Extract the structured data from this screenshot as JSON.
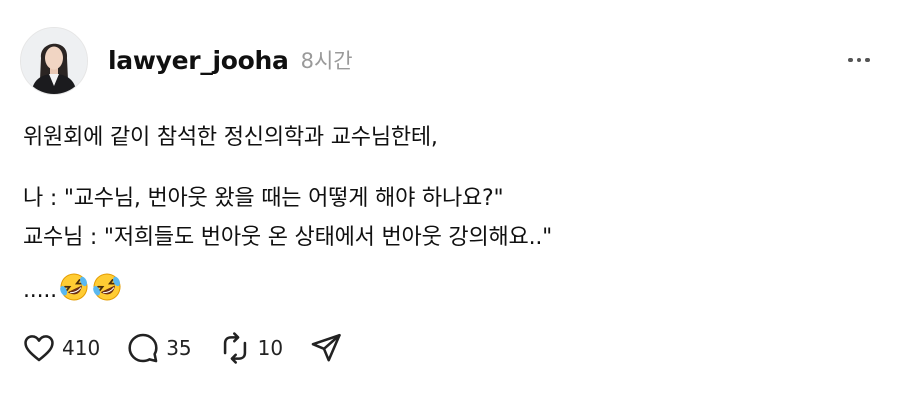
{
  "post": {
    "author": {
      "username": "lawyer_jooha",
      "avatar_icon": "profile-photo-avatar"
    },
    "time": "8시간",
    "more_icon": "more-horizontal-icon",
    "lines": [
      "위원회에 같이 참석한 정신의학과 교수님한테,",
      "나 : \"교수님, 번아웃 왔을 때는 어떻게 해야 하나요?\"",
      "교수님 : \"저희들도 번아웃 온 상태에서 번아웃 강의해요..\"",
      "....."
    ],
    "emojis": [
      "rolling-on-the-floor-laughing",
      "rolling-on-the-floor-laughing"
    ]
  },
  "actions": {
    "like": {
      "icon": "heart-icon",
      "count": "410"
    },
    "reply": {
      "icon": "comment-icon",
      "count": "35"
    },
    "repost": {
      "icon": "repost-icon",
      "count": "10"
    },
    "share": {
      "icon": "send-icon"
    }
  },
  "colors": {
    "text": "#101010",
    "muted": "#9a9a9a",
    "icon": "#222222",
    "background": "#ffffff"
  }
}
